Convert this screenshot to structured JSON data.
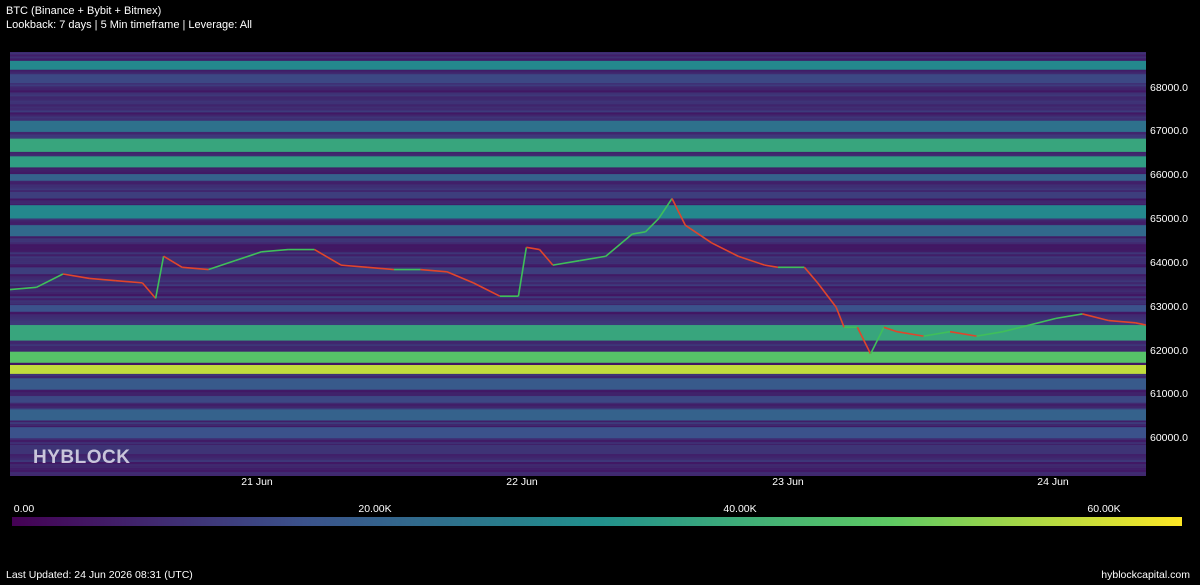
{
  "header": {
    "title": "BTC (Binance + Bybit + Bitmex)",
    "subtitle": "Lookback: 7 days | 5 Min timeframe | Leverage: All"
  },
  "watermark": "HYBLOCK",
  "footer": {
    "last_updated": "Last Updated: 24 Jun 2026 08:31 (UTC)",
    "site": "hyblockcapital.com"
  },
  "colors": {
    "background": "#000000",
    "viridis": [
      "#440154",
      "#3b528b",
      "#21908d",
      "#5dc963",
      "#fde725"
    ],
    "candle_up": "#3fbf5a",
    "candle_down": "#e0452b"
  },
  "chart_data": {
    "type": "heatmap",
    "title": "BTC (Binance + Bybit + Bitmex)",
    "subtitle": "Lookback: 7 days | 5 Min timeframe | Leverage: All",
    "y_ticks": [
      "68000.0",
      "67000.0",
      "66000.0",
      "65000.0",
      "64000.0",
      "63000.0",
      "62000.0",
      "61000.0",
      "60000.0"
    ],
    "y_tick_values": [
      68000,
      67000,
      66000,
      65000,
      64000,
      63000,
      62000,
      61000,
      60000
    ],
    "ylim": [
      59250,
      68800
    ],
    "x_ticks": [
      "21 Jun",
      "22 Jun",
      "23 Jun",
      "24 Jun"
    ],
    "x_tick_values": [
      1.0,
      2.0,
      3.0,
      4.0
    ],
    "xlim": [
      0.05,
      4.34
    ],
    "colorbar": {
      "ticks": [
        "0.00",
        "20.00K",
        "40.00K",
        "60.00K"
      ],
      "tick_values": [
        0,
        20000,
        40000,
        60000
      ],
      "range": [
        0,
        64000
      ]
    },
    "price_series": {
      "x": [
        0.05,
        0.15,
        0.25,
        0.35,
        0.45,
        0.55,
        0.6,
        0.63,
        0.7,
        0.8,
        0.9,
        1.0,
        1.1,
        1.2,
        1.3,
        1.4,
        1.5,
        1.6,
        1.7,
        1.8,
        1.9,
        1.97,
        2.0,
        2.05,
        2.1,
        2.2,
        2.3,
        2.4,
        2.45,
        2.5,
        2.55,
        2.6,
        2.7,
        2.8,
        2.9,
        2.95,
        3.05,
        3.1,
        3.17,
        3.2,
        3.25,
        3.3,
        3.35,
        3.4,
        3.5,
        3.6,
        3.7,
        3.8,
        3.9,
        4.0,
        4.1,
        4.2,
        4.3,
        4.34
      ],
      "y": [
        63450,
        63500,
        63800,
        63700,
        63650,
        63600,
        63250,
        64200,
        63950,
        63900,
        64100,
        64300,
        64350,
        64350,
        64000,
        63950,
        63900,
        63900,
        63850,
        63600,
        63300,
        63300,
        64400,
        64350,
        64000,
        64100,
        64200,
        64700,
        64750,
        65050,
        65500,
        64900,
        64500,
        64200,
        64000,
        63950,
        63950,
        63600,
        63050,
        62600,
        62600,
        62000,
        62600,
        62500,
        62400,
        62500,
        62400,
        62500,
        62650,
        62800,
        62900,
        62750,
        62700,
        62650
      ]
    },
    "bands": [
      {
        "low": 68400,
        "high": 68600,
        "value": 30000
      },
      {
        "low": 68100,
        "high": 68300,
        "value": 14000
      },
      {
        "low": 67000,
        "high": 67250,
        "value": 24000
      },
      {
        "low": 66550,
        "high": 66850,
        "value": 38000
      },
      {
        "low": 66200,
        "high": 66450,
        "value": 36000
      },
      {
        "low": 65900,
        "high": 66050,
        "value": 20000
      },
      {
        "low": 65500,
        "high": 65650,
        "value": 12000
      },
      {
        "low": 65050,
        "high": 65350,
        "value": 30000
      },
      {
        "low": 64650,
        "high": 64900,
        "value": 22000
      },
      {
        "low": 63800,
        "high": 63950,
        "value": 12000
      },
      {
        "low": 62950,
        "high": 63100,
        "value": 16000
      },
      {
        "low": 62300,
        "high": 62650,
        "value": 38000
      },
      {
        "low": 61800,
        "high": 62050,
        "value": 46000
      },
      {
        "low": 61550,
        "high": 61750,
        "value": 58000
      },
      {
        "low": 61200,
        "high": 61450,
        "value": 18000
      },
      {
        "low": 60900,
        "high": 61050,
        "value": 14000
      },
      {
        "low": 60500,
        "high": 60750,
        "value": 20000
      },
      {
        "low": 60100,
        "high": 60350,
        "value": 16000
      },
      {
        "low": 59750,
        "high": 59950,
        "value": 10000
      }
    ]
  }
}
